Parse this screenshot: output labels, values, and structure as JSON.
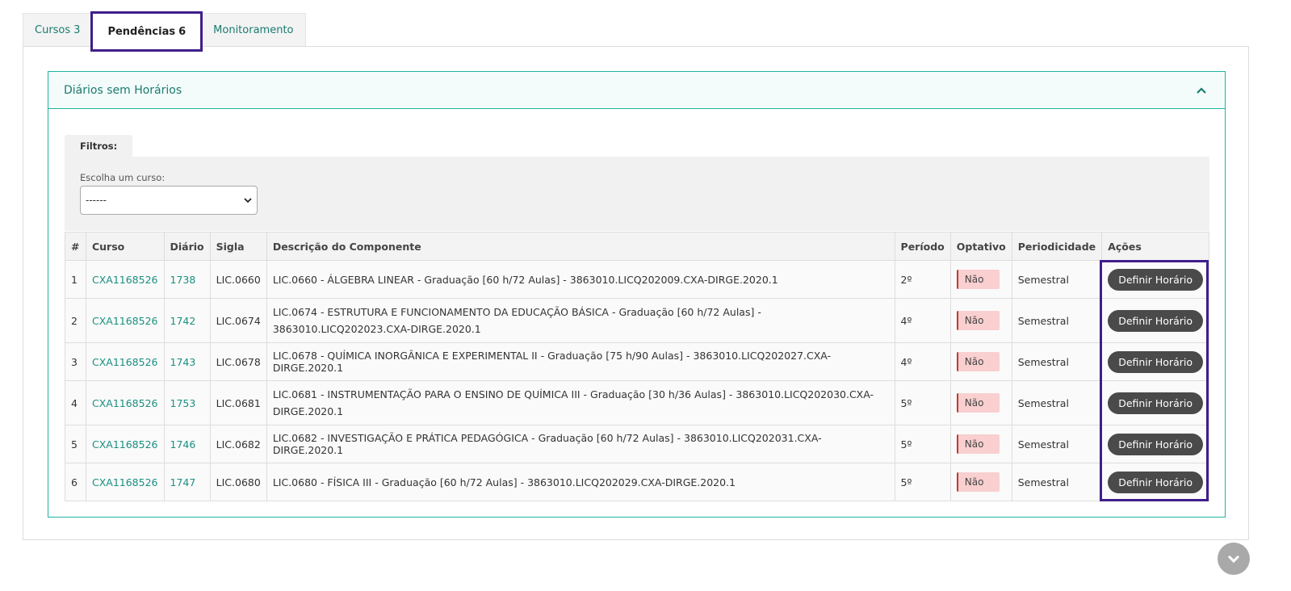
{
  "tabs": [
    {
      "label": "Cursos",
      "count": "3"
    },
    {
      "label": "Pendências",
      "count": "6"
    },
    {
      "label": "Monitoramento",
      "count": ""
    }
  ],
  "box": {
    "title": "Diários sem Horários"
  },
  "filters": {
    "tab_label": "Filtros:",
    "course_label": "Escolha um curso:",
    "course_value": "------"
  },
  "table": {
    "headers": [
      "#",
      "Curso",
      "Diário",
      "Sigla",
      "Descrição do Componente",
      "Período",
      "Optativo",
      "Periodicidade",
      "Ações"
    ],
    "rows": [
      {
        "n": "1",
        "curso": "CXA1168526",
        "diario": "1738",
        "sigla": "LIC.0660",
        "descricao": "LIC.0660 - ÁLGEBRA LINEAR - Graduação [60 h/72 Aulas] - 3863010.LICQ202009.CXA-DIRGE.2020.1",
        "periodo": "2º",
        "optativo": "Não",
        "periodicidade": "Semestral",
        "acao": "Definir Horário"
      },
      {
        "n": "2",
        "curso": "CXA1168526",
        "diario": "1742",
        "sigla": "LIC.0674",
        "descricao": "LIC.0674 - ESTRUTURA E FUNCIONAMENTO DA EDUCAÇÃO BÁSICA - Graduação [60 h/72 Aulas] - 3863010.LICQ202023.CXA-DIRGE.2020.1",
        "periodo": "4º",
        "optativo": "Não",
        "periodicidade": "Semestral",
        "acao": "Definir Horário"
      },
      {
        "n": "3",
        "curso": "CXA1168526",
        "diario": "1743",
        "sigla": "LIC.0678",
        "descricao": "LIC.0678 - QUÍMICA INORGÂNICA E EXPERIMENTAL II - Graduação [75 h/90 Aulas] - 3863010.LICQ202027.CXA-DIRGE.2020.1",
        "periodo": "4º",
        "optativo": "Não",
        "periodicidade": "Semestral",
        "acao": "Definir Horário"
      },
      {
        "n": "4",
        "curso": "CXA1168526",
        "diario": "1753",
        "sigla": "LIC.0681",
        "descricao": "LIC.0681 - INSTRUMENTAÇÃO PARA O ENSINO DE QUÍMICA III - Graduação [30 h/36 Aulas] - 3863010.LICQ202030.CXA-DIRGE.2020.1",
        "periodo": "5º",
        "optativo": "Não",
        "periodicidade": "Semestral",
        "acao": "Definir Horário"
      },
      {
        "n": "5",
        "curso": "CXA1168526",
        "diario": "1746",
        "sigla": "LIC.0682",
        "descricao": "LIC.0682 - INVESTIGAÇÃO E PRÁTICA PEDAGÓGICA - Graduação [60 h/72 Aulas] - 3863010.LICQ202031.CXA-DIRGE.2020.1",
        "periodo": "5º",
        "optativo": "Não",
        "periodicidade": "Semestral",
        "acao": "Definir Horário"
      },
      {
        "n": "6",
        "curso": "CXA1168526",
        "diario": "1747",
        "sigla": "LIC.0680",
        "descricao": "LIC.0680 - FÍSICA III - Graduação [60 h/72 Aulas] - 3863010.LICQ202029.CXA-DIRGE.2020.1",
        "periodo": "5º",
        "optativo": "Não",
        "periodicidade": "Semestral",
        "acao": "Definir Horário"
      }
    ]
  },
  "colors": {
    "accent": "#1a7b6f",
    "highlight": "#3f1e8c",
    "badge_bg": "#f9cfcf",
    "button_bg": "#4a4a4a"
  }
}
